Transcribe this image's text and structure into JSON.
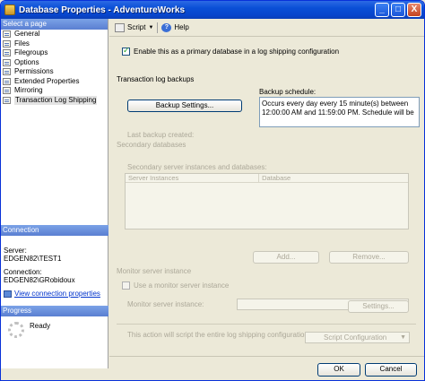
{
  "window": {
    "title": "Database Properties - AdventureWorks",
    "min_glyph": "_",
    "max_glyph": "□",
    "close_glyph": "X"
  },
  "left": {
    "select_page_header": "Select a page",
    "pages": [
      "General",
      "Files",
      "Filegroups",
      "Options",
      "Permissions",
      "Extended Properties",
      "Mirroring",
      "Transaction Log Shipping"
    ],
    "selected_index": 7,
    "connection_header": "Connection",
    "server_label": "Server:",
    "server_value": "EDGEN82\\TEST1",
    "connection_label": "Connection:",
    "connection_value": "EDGEN82\\GRobidoux",
    "view_connection_link": "View connection properties",
    "progress_header": "Progress",
    "progress_status": "Ready"
  },
  "toolbar": {
    "script_label": "Script",
    "help_label": "Help"
  },
  "main": {
    "enable_primary_label": "Enable this as a primary database in a log shipping configuration",
    "enable_primary_checked": true,
    "tlog_backups_label": "Transaction log backups",
    "backup_schedule_label": "Backup schedule:",
    "backup_settings_button": "Backup Settings...",
    "schedule_text": "Occurs every day every 15 minute(s) between 12:00:00 AM and 11:59:00 PM. Schedule will be",
    "last_backup_label": "Last backup created:",
    "secondary_db_label": "Secondary databases",
    "secondary_instances_label": "Secondary server instances and databases:",
    "grid_columns": [
      "Server Instances",
      "Database"
    ],
    "add_button": "Add...",
    "remove_button": "Remove...",
    "monitor_section_label": "Monitor server instance",
    "use_monitor_label": "Use a monitor server instance",
    "monitor_instance_label": "Monitor server instance:",
    "settings_button": "Settings...",
    "script_note": "This action will script the entire log shipping configuration.",
    "script_config_button": "Script Configuration"
  },
  "footer": {
    "ok_button": "OK",
    "cancel_button": "Cancel"
  }
}
